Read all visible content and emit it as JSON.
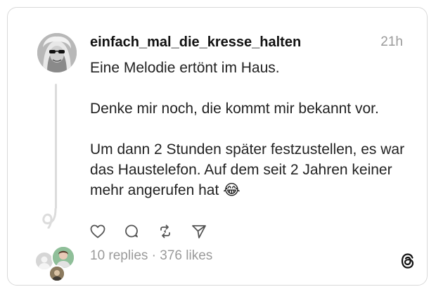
{
  "post": {
    "username": "einfach_mal_die_kresse_halten",
    "time": "21h",
    "paragraphs": [
      "Eine Melodie ertönt im Haus.",
      "Denke mir noch, die kommt mir bekannt vor.",
      "Um dann 2 Stunden später festzustellen, es war das Haustelefon. Auf dem seit 2 Jahren keiner mehr angerufen hat 😂"
    ],
    "stats": "10 replies · 376 likes"
  },
  "icons": {
    "like": "heart-icon",
    "reply": "comment-icon",
    "repost": "repost-icon",
    "share": "send-icon",
    "brand": "threads-logo-icon"
  },
  "colors": {
    "text": "#222222",
    "muted": "#9a9a9a",
    "border": "#d9d9d9"
  }
}
